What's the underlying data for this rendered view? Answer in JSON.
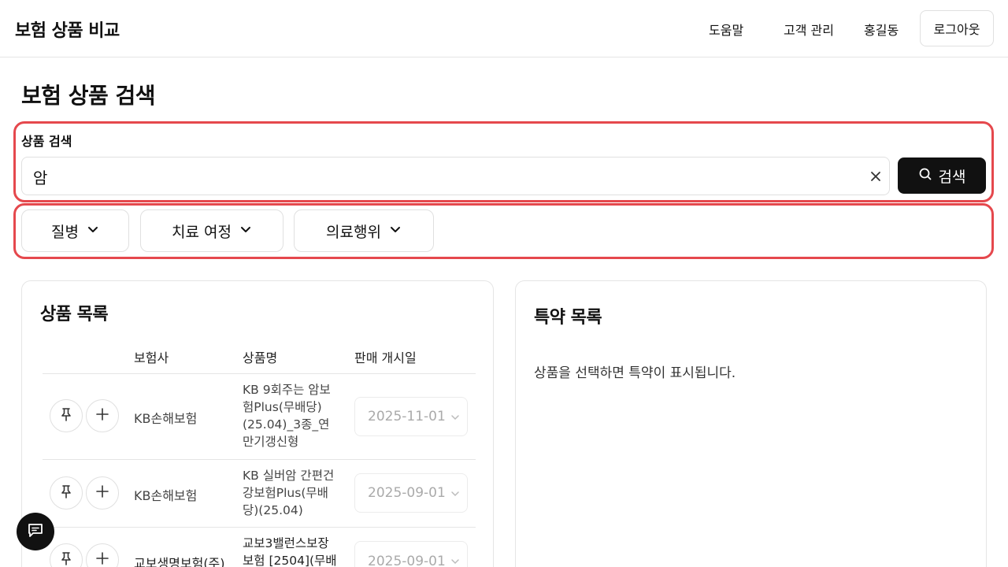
{
  "header": {
    "brand": "보험 상품 비교",
    "nav": {
      "help": "도움말",
      "customers": "고객 관리",
      "user_name": "홍길동",
      "logout": "로그아웃"
    }
  },
  "page": {
    "title": "보험 상품 검색"
  },
  "search": {
    "label": "상품 검색",
    "value": "암",
    "button_label": "검색",
    "icons": {
      "search": "search-icon",
      "clear": "close-icon"
    }
  },
  "filters": [
    {
      "label": "질병"
    },
    {
      "label": "치료 여정"
    },
    {
      "label": "의료행위"
    }
  ],
  "products": {
    "title": "상품 목록",
    "columns": [
      "보험사",
      "상품명",
      "판매 개시일"
    ],
    "rows": [
      {
        "company": "KB손해보험",
        "product_lines": [
          "KB 9회주는 암보",
          "험Plus(무배당)",
          "(25.04)_3종_연",
          "만기갱신형"
        ],
        "start_date": "2025-11-01"
      },
      {
        "company": "KB손해보험",
        "product_lines": [
          "KB 실버암 간편건",
          "강보험Plus(무배",
          "당)(25.04)"
        ],
        "start_date": "2025-09-01"
      },
      {
        "company": "교보생명보험(주)",
        "product_lines": [
          "교보3밸런스보장",
          "보험 [2504](무배"
        ],
        "start_date": "2025-09-01"
      }
    ],
    "row_icons": {
      "pin": "pin-icon",
      "add": "plus-icon"
    }
  },
  "riders": {
    "title": "특약 목록",
    "empty_message": "상품을 선택하면 특약이 표시됩니다."
  },
  "chat": {
    "icon": "chat-icon"
  },
  "colors": {
    "highlight": "#e5484d",
    "primary": "#111111"
  }
}
